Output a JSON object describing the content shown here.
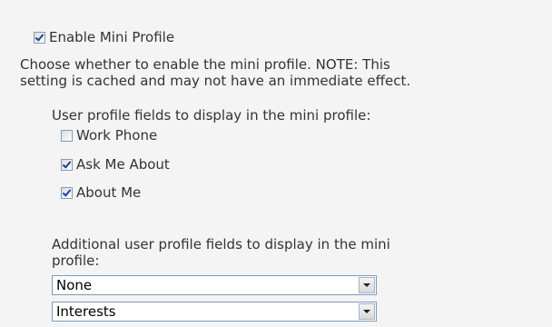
{
  "enable": {
    "label": "Enable Mini Profile",
    "checked": true,
    "description_line1": "Choose whether to enable the mini profile. NOTE: This",
    "description_line2": "setting is cached and may not have an immediate effect."
  },
  "fields": {
    "heading": "User profile fields to display in the mini profile:",
    "items": [
      {
        "label": "Work Phone",
        "checked": false
      },
      {
        "label": "Ask Me About",
        "checked": true
      },
      {
        "label": "About Me",
        "checked": true
      }
    ]
  },
  "additional": {
    "heading_line1": "Additional user profile fields to display in the mini",
    "heading_line2": "profile:",
    "selects": [
      {
        "value": "None"
      },
      {
        "value": "Interests"
      }
    ]
  }
}
